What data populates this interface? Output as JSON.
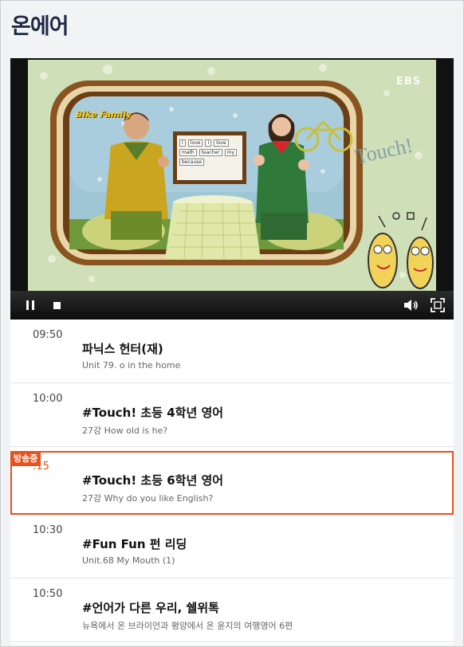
{
  "page": {
    "title": "온에어"
  },
  "player": {
    "watermark": "EBS",
    "show_logo": "Bike Family",
    "board_words": [
      "I",
      "love",
      "I",
      "love",
      "math",
      "teacher",
      "my",
      "because"
    ],
    "backdrop_text": "Touch!",
    "controls": {
      "pause": "pause-icon",
      "stop": "stop-icon",
      "volume": "volume-icon",
      "fullscreen": "fullscreen-icon"
    }
  },
  "schedule": [
    {
      "time": "09:50",
      "title": "파닉스 헌터(재)",
      "subtitle": "Unit 79. o in the home",
      "live": false
    },
    {
      "time": "10:00",
      "title": "#Touch! 초등 4학년 영어",
      "subtitle": "27강 How old is he?",
      "live": false
    },
    {
      "time": ":15",
      "title": "#Touch! 초등 6학년 영어",
      "subtitle": "27강 Why do you like English?",
      "live": true,
      "badge": "방송중"
    },
    {
      "time": "10:30",
      "title": "#Fun Fun 펀 리딩",
      "subtitle": "Unit.68 My Mouth (1)",
      "live": false
    },
    {
      "time": "10:50",
      "title": "#언어가 다른 우리, 쉘위톡",
      "subtitle": "뉴욕에서 온 브라이언과 평양에서 온 윤지의 여행영어 6편",
      "live": false
    }
  ],
  "colors": {
    "accent": "#e8521e",
    "title": "#1d2a44",
    "background": "#f2f3f5"
  }
}
